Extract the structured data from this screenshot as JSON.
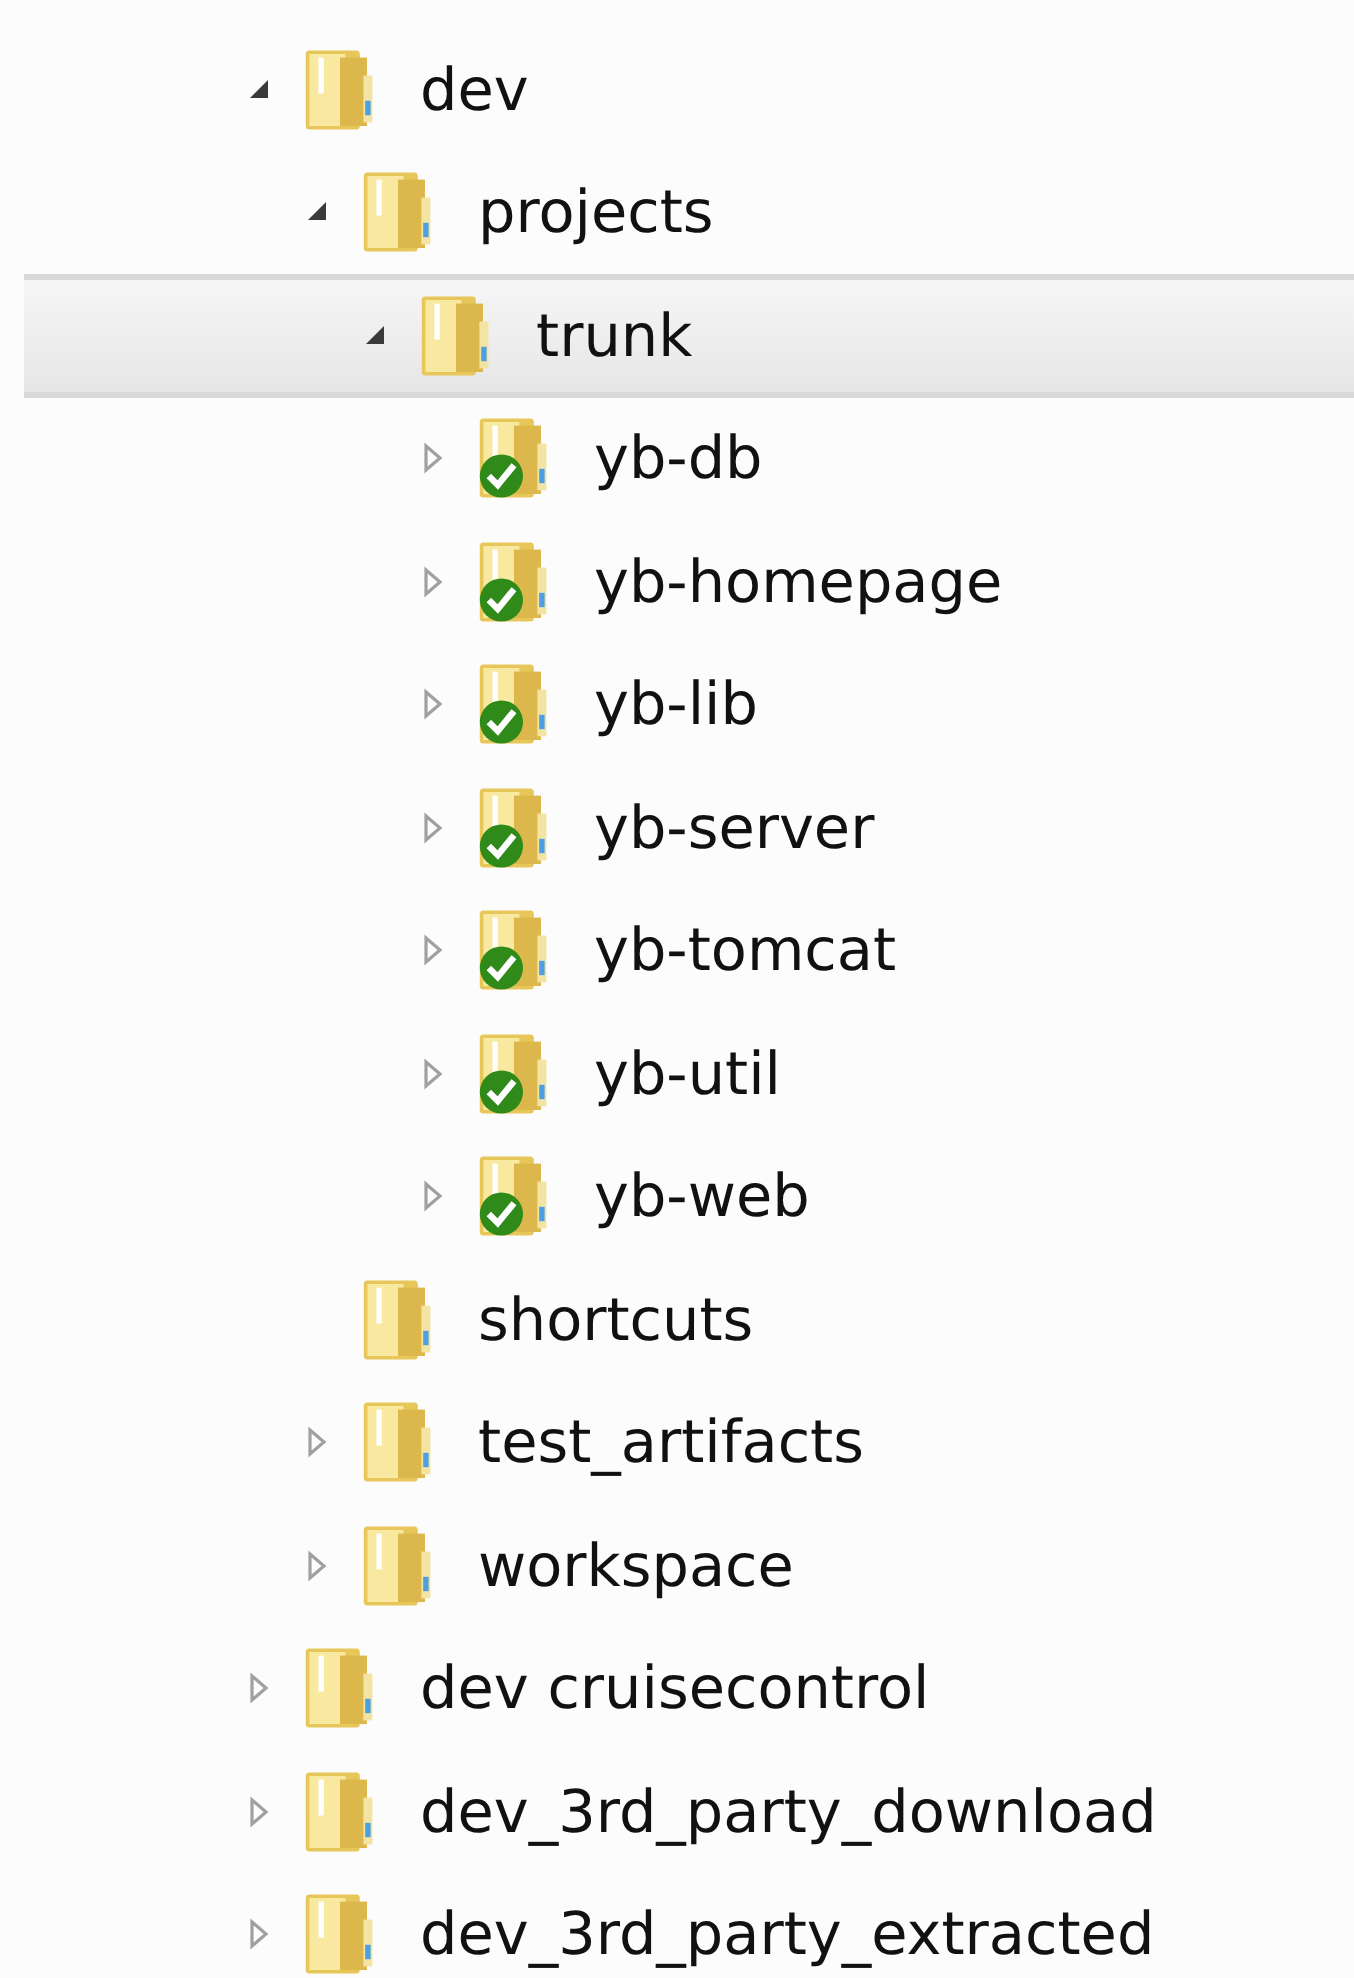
{
  "tree": [
    {
      "label": "dev",
      "expandable": true,
      "expanded": true,
      "selected": false,
      "versioned": false,
      "children": [
        {
          "label": "projects",
          "expandable": true,
          "expanded": true,
          "selected": false,
          "versioned": false,
          "children": [
            {
              "label": "trunk",
              "expandable": true,
              "expanded": true,
              "selected": true,
              "versioned": false,
              "children": [
                {
                  "label": "yb-db",
                  "expandable": true,
                  "expanded": false,
                  "selected": false,
                  "versioned": true
                },
                {
                  "label": "yb-homepage",
                  "expandable": true,
                  "expanded": false,
                  "selected": false,
                  "versioned": true
                },
                {
                  "label": "yb-lib",
                  "expandable": true,
                  "expanded": false,
                  "selected": false,
                  "versioned": true
                },
                {
                  "label": "yb-server",
                  "expandable": true,
                  "expanded": false,
                  "selected": false,
                  "versioned": true
                },
                {
                  "label": "yb-tomcat",
                  "expandable": true,
                  "expanded": false,
                  "selected": false,
                  "versioned": true
                },
                {
                  "label": "yb-util",
                  "expandable": true,
                  "expanded": false,
                  "selected": false,
                  "versioned": true
                },
                {
                  "label": "yb-web",
                  "expandable": true,
                  "expanded": false,
                  "selected": false,
                  "versioned": true
                }
              ]
            }
          ]
        },
        {
          "label": "shortcuts",
          "expandable": false,
          "selected": false,
          "versioned": false
        },
        {
          "label": "test_artifacts",
          "expandable": true,
          "expanded": false,
          "selected": false,
          "versioned": false
        },
        {
          "label": "workspace",
          "expandable": true,
          "expanded": false,
          "selected": false,
          "versioned": false
        }
      ]
    },
    {
      "label": "dev cruisecontrol",
      "expandable": true,
      "expanded": false,
      "selected": false,
      "versioned": false
    },
    {
      "label": "dev_3rd_party_download",
      "expandable": true,
      "expanded": false,
      "selected": false,
      "versioned": false
    },
    {
      "label": "dev_3rd_party_extracted",
      "expandable": true,
      "expanded": false,
      "selected": false,
      "versioned": false
    }
  ]
}
